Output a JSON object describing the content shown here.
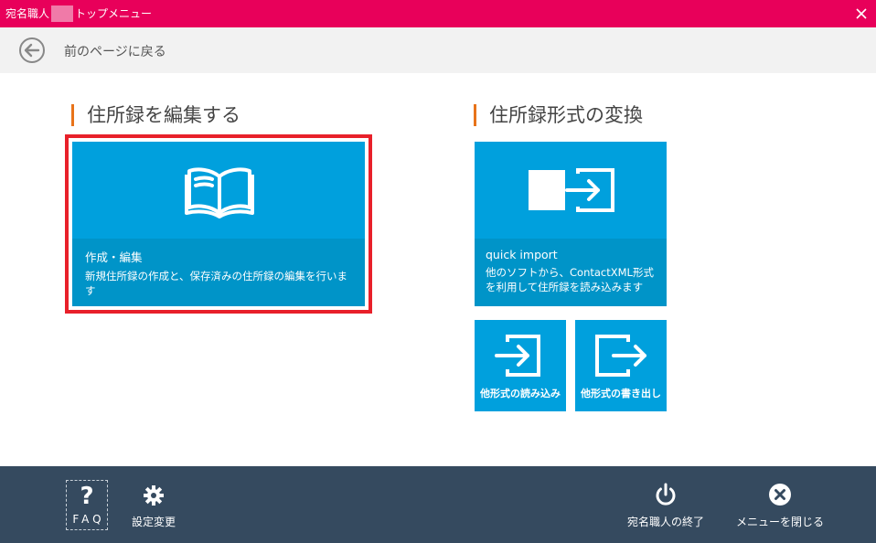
{
  "window": {
    "title_prefix": "宛名職人",
    "title_suffix": "トップメニュー"
  },
  "nav": {
    "back_label": "前のページに戻る"
  },
  "sections": {
    "edit_title": "住所録を編集する",
    "convert_title": "住所録形式の変換"
  },
  "tiles": {
    "edit": {
      "title": "作成・編集",
      "description": "新規住所録の作成と、保存済みの住所録の編集を行います",
      "icon": "open-book-icon"
    },
    "quick_import": {
      "title": "quick import",
      "description": "他のソフトから、ContactXML形式を利用して住所録を読み込みます",
      "icon": "square-arrow-import-icon"
    },
    "import_other": {
      "label": "他形式の読み込み",
      "icon": "import-icon"
    },
    "export_other": {
      "label": "他形式の書き出し",
      "icon": "export-icon"
    }
  },
  "footer": {
    "faq_symbol": "?",
    "faq_label": "FAQ",
    "settings_label": "設定変更",
    "quit_label": "宛名職人の終了",
    "close_menu_label": "メニューを閉じる"
  },
  "colors": {
    "titlebar": "#e8005a",
    "tile": "#00a0dd",
    "accent": "#e8731a",
    "footer": "#354a5f",
    "selection": "#e8202a"
  }
}
